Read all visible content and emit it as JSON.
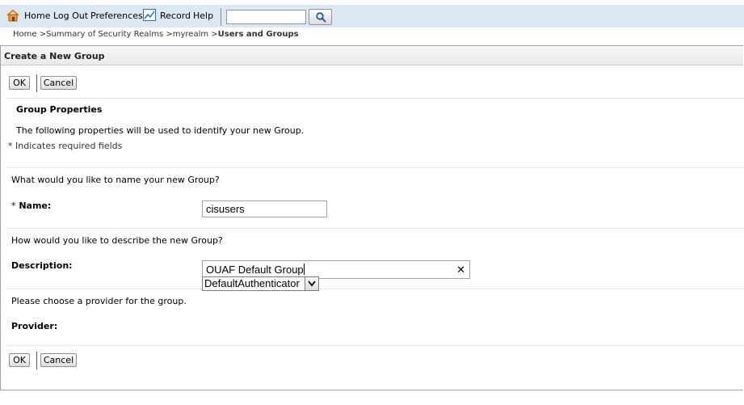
{
  "toolbar": {
    "home": "Home",
    "logout": "Log Out",
    "preferences": "Preferences",
    "record": "Record",
    "help": "Help",
    "search_value": ""
  },
  "breadcrumb": {
    "home": "Home >",
    "realms": "Summary of Security Realms >",
    "realm": "myrealm >",
    "current": "Users and Groups"
  },
  "panel": {
    "title": "Create a New Group",
    "ok": "OK",
    "cancel": "Cancel",
    "section_title": "Group Properties",
    "section_desc": "The following properties will be used to identify your new Group.",
    "required_note": "* Indicates required fields",
    "name_question": "What would you like to name your new Group?",
    "name_asterisk": "*",
    "name_label": "Name:",
    "name_value": "cisusers",
    "desc_question": "How would you like to describe the new Group?",
    "desc_label": "Description:",
    "desc_value": "OUAF Default Group",
    "clear_glyph": "✕",
    "provider_question": "Please choose a provider for the group.",
    "provider_label": "Provider:",
    "provider_value": "DefaultAuthenticator"
  },
  "colors": {
    "toolbar_bg": "#dde8f3",
    "icon_orange": "#d9822b",
    "icon_blue": "#2a6fb0"
  }
}
